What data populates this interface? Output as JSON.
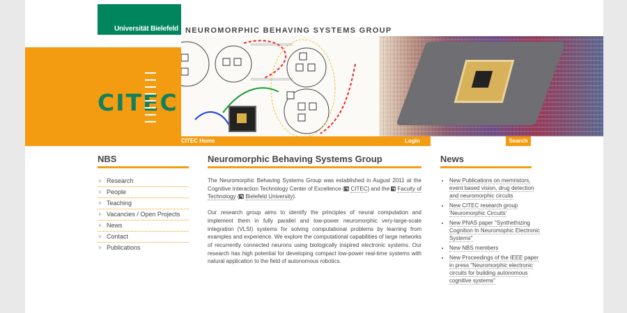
{
  "header": {
    "university": "Universität Bielefeld",
    "site_title": "NEUROMORPHIC  BEHAVING  SYSTEMS  GROUP",
    "citec_logo": "CITEC"
  },
  "nav": {
    "citec_home": "CITEC Home",
    "login": "Login",
    "search_placeholder": "",
    "search_button": "Search"
  },
  "sidebar": {
    "title": "NBS",
    "items": [
      {
        "label": "Research"
      },
      {
        "label": "People"
      },
      {
        "label": "Teaching"
      },
      {
        "label": "Vacancies / Open Projects"
      },
      {
        "label": "News"
      },
      {
        "label": "Contact"
      },
      {
        "label": "Publications"
      }
    ]
  },
  "main": {
    "title": "Neuromorphic Behaving Systems Group",
    "p1_a": "The Neuromorphic Behaving Systems Group was established in August 2011 at the Cognitive Interaction Technology Center of Excellence (",
    "p1_link1": "CITEC",
    "p1_b": ") and the ",
    "p1_link2": "Faculty of Technology",
    "p1_c": " (",
    "p1_link3": "Bielefeld University",
    "p1_d": ").",
    "p2": "Our research group aims to identify the principles of neural computation and implement them in fully parallel and low-power neuromorphic very-large-scale integration (VLSI) systems for solving computational problems by learning from examples and experience. We explore the computational capabilities of large networks of recurrently connected neurons using biologically inspired electronic systems. Our research has high potential for developing compact low-power real-time systems with natural application to the field of autonomous robotics."
  },
  "news": {
    "title": "News",
    "items": [
      {
        "label": "New Publications on memristors, event based vision, drug detection and neuromorphic circuits"
      },
      {
        "label": "New CITEC research group 'Neuromorphic Circuits'"
      },
      {
        "label": "New PNAS paper \"Synthethizing Cognition In Neuromophic Electronic Systems\""
      },
      {
        "label": "New NBS members"
      },
      {
        "label": "New Proceedings of the IEEE paper in press \"Neuromorphic electronic circuits for building autonomous cognitive systems\""
      }
    ]
  },
  "colors": {
    "accent": "#f39c12",
    "brand_green": "#00855c"
  }
}
